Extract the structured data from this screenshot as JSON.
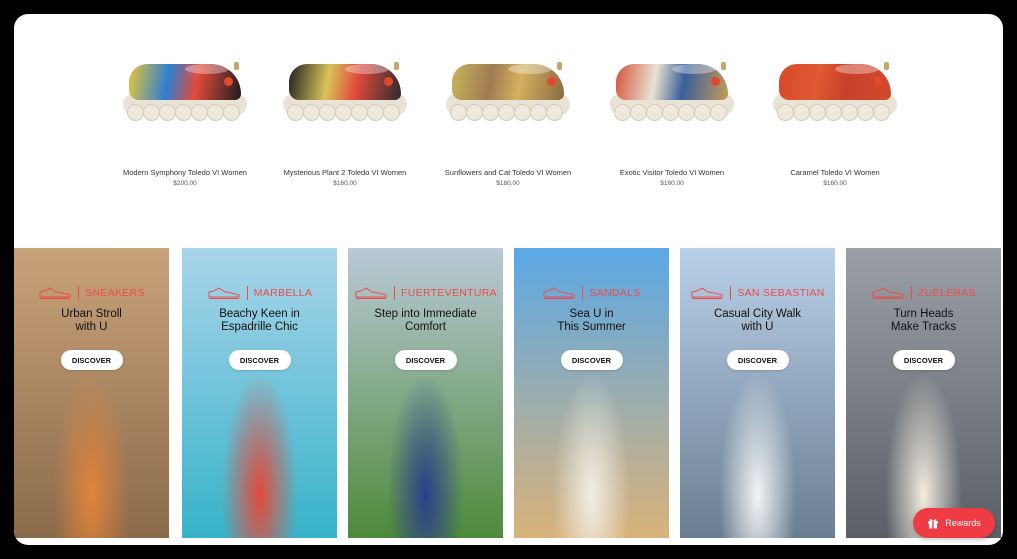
{
  "products": [
    {
      "name": "Modern Symphony Toledo VI Women",
      "price": "$200.00",
      "colors": [
        "#e8c63a",
        "#2f7fd1",
        "#e24a3b",
        "#1d1d1d"
      ]
    },
    {
      "name": "Mysterious Plant 2 Toledo VI Women",
      "price": "$160.00",
      "colors": [
        "#1f1f22",
        "#d8c35a",
        "#e14a3a",
        "#2c2c30"
      ]
    },
    {
      "name": "Sunflowers and Cat Toledo VI Women",
      "price": "$180.00",
      "colors": [
        "#c8b45a",
        "#a07b52",
        "#d4b060",
        "#8b6a40"
      ]
    },
    {
      "name": "Exotic Visitor Toledo VI Women",
      "price": "$160.00",
      "colors": [
        "#d4533a",
        "#e9e2d2",
        "#3a5f9a",
        "#c79a5a"
      ]
    },
    {
      "name": "Caramel Toledo VI Women",
      "price": "$160.00",
      "colors": [
        "#d9482b",
        "#e05a33",
        "#c8402a",
        "#d14a2e"
      ]
    }
  ],
  "banners": [
    {
      "category": "SNEAKERS",
      "tagline_1": "Urban Stroll",
      "tagline_2": "with U",
      "button": "DISCOVER",
      "bg_top": "#c9a27a",
      "bg_bottom": "#8a6a4a",
      "accent": "#e0843a"
    },
    {
      "category": "MARBELLA",
      "tagline_1": "Beachy Keen in",
      "tagline_2": "Espadrille Chic",
      "button": "DISCOVER",
      "bg_top": "#a9d4ea",
      "bg_bottom": "#37b3c9",
      "accent": "#e24a3b"
    },
    {
      "category": "FUERTEVENTURA",
      "tagline_1": "Step into Immediate",
      "tagline_2": "Comfort",
      "button": "DISCOVER",
      "bg_top": "#b9c9d8",
      "bg_bottom": "#4e8a3a",
      "accent": "#2a3f8a"
    },
    {
      "category": "SANDALS",
      "tagline_1": "Sea U in",
      "tagline_2": "This Summer",
      "button": "DISCOVER",
      "bg_top": "#5aa8e6",
      "bg_bottom": "#d9b27a",
      "accent": "#f2eee6"
    },
    {
      "category": "SAN SEBASTIAN",
      "tagline_1": "Casual City Walk",
      "tagline_2": "with U",
      "button": "DISCOVER",
      "bg_top": "#b8d0e8",
      "bg_bottom": "#6a7e92",
      "accent": "#f4f4f4"
    },
    {
      "category": "ZUELERAS",
      "tagline_1": "Turn Heads",
      "tagline_2": "Make Tracks",
      "button": "DISCOVER",
      "bg_top": "#9aa0a6",
      "bg_bottom": "#5a5f66",
      "accent": "#f3ece0"
    }
  ],
  "rewards": {
    "label": "Rewards",
    "color": "#ef3b43",
    "icon": "gift-icon"
  }
}
